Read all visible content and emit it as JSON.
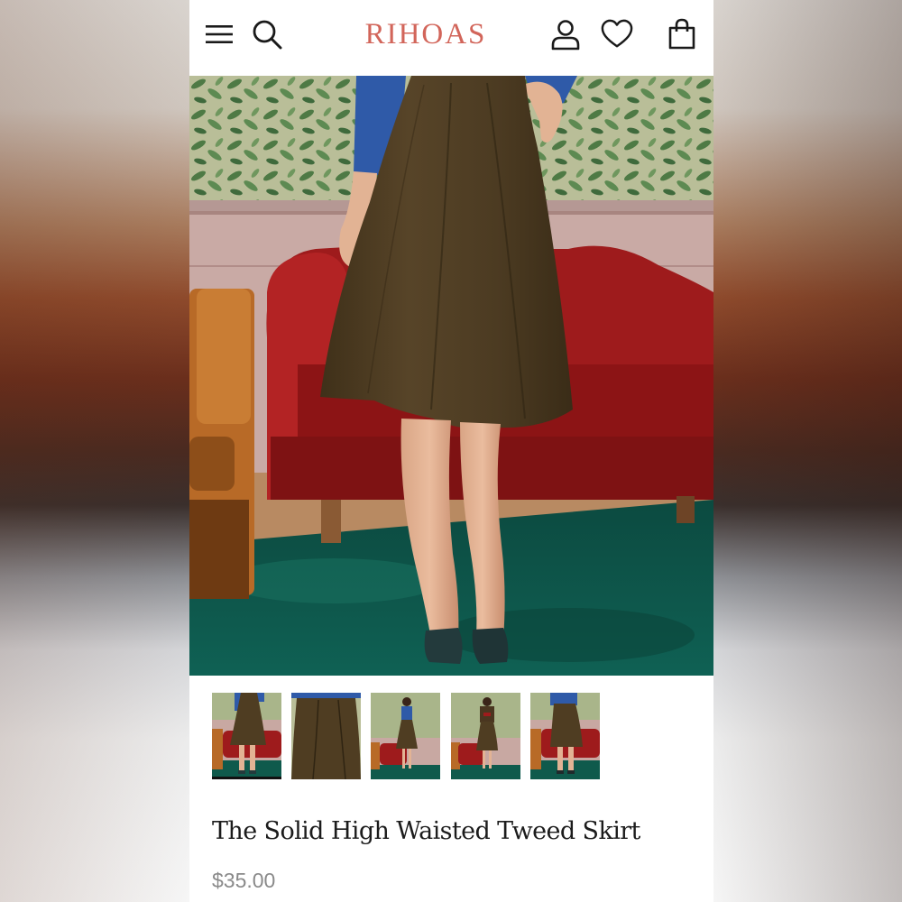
{
  "header": {
    "logo": "RIHOAS",
    "icons": [
      "menu-icon",
      "search-icon",
      "account-icon",
      "wishlist-icon",
      "cart-icon"
    ]
  },
  "product": {
    "title": "The Solid High Waisted Tweed Skirt",
    "price": "$35.00",
    "thumbnails": [
      {
        "name": "front-view",
        "selected": true
      },
      {
        "name": "fabric-detail",
        "selected": false
      },
      {
        "name": "full-outfit-front",
        "selected": false
      },
      {
        "name": "full-outfit-jacket",
        "selected": false
      },
      {
        "name": "back-view",
        "selected": false
      }
    ]
  },
  "colors": {
    "logo": "#d2655a",
    "skirt": "#4f3d22",
    "sofa": "#9e1b1c",
    "carpet": "#0f5a4c",
    "wallpaper": "#a9b58a",
    "sweater": "#2f5aa8"
  }
}
